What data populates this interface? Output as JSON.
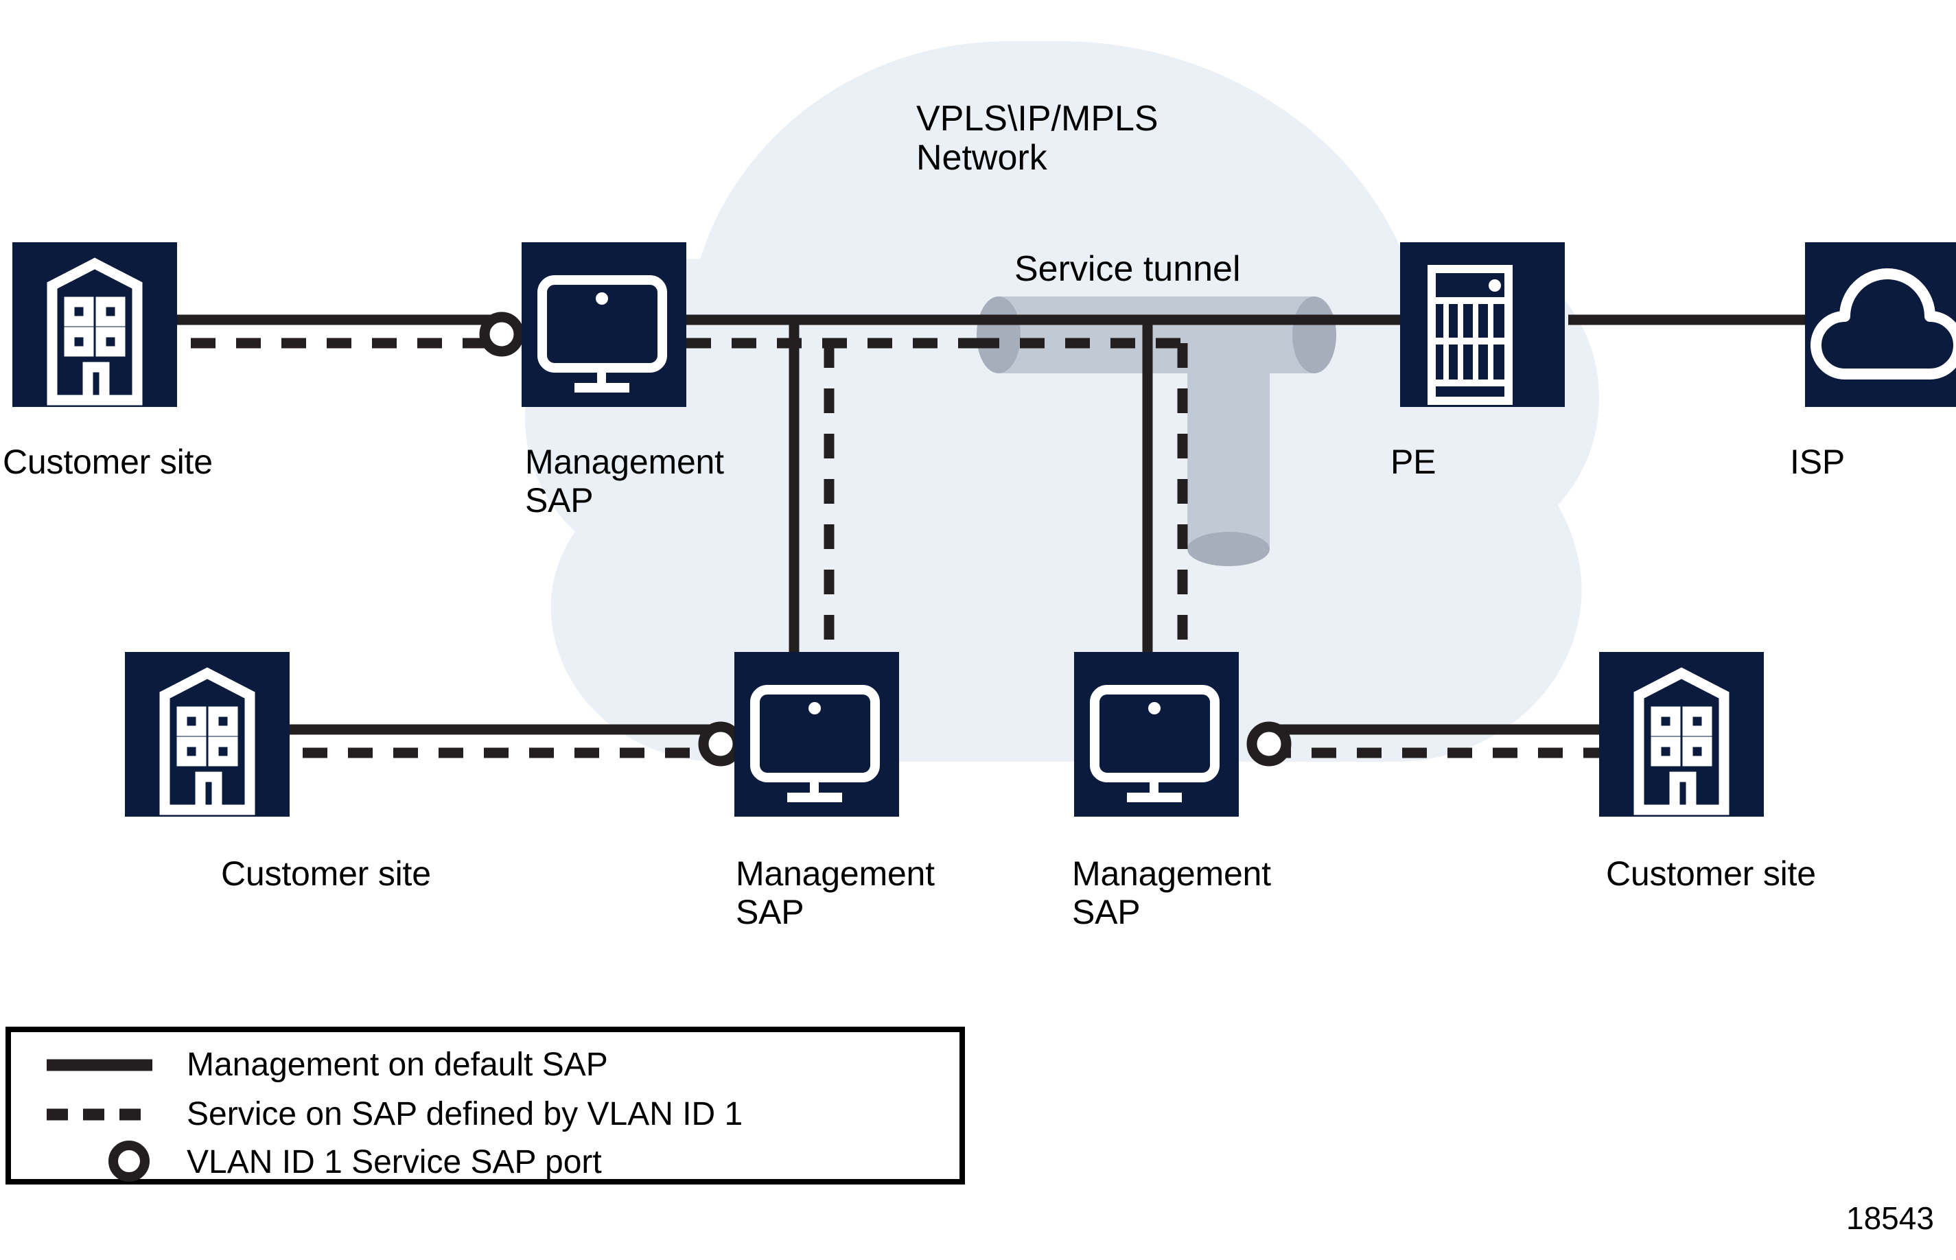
{
  "figure": {
    "number": "18543",
    "background_color": "#ffffff",
    "cloud_color": "#eaf0f5",
    "node_box_color": "#0a1b3d",
    "node_icon_color": "#ffffff",
    "line_color": "#231f20",
    "tunnel_body_color": "#c1c9d4",
    "tunnel_cap_color": "#a5aeba"
  },
  "cloud": {
    "title": "VPLS\\IP/MPLS\nNetwork"
  },
  "tunnel": {
    "label": "Service tunnel"
  },
  "nodes": [
    {
      "id": "customer-site-top-left",
      "label": "Customer site",
      "icon": "building-icon"
    },
    {
      "id": "management-sap-top-left",
      "label": "Management\nSAP",
      "icon": "monitor-icon"
    },
    {
      "id": "pe-router",
      "label": "PE",
      "icon": "router-rack-icon"
    },
    {
      "id": "isp-cloud",
      "label": "ISP",
      "icon": "cloud-icon"
    },
    {
      "id": "customer-site-bottom-left",
      "label": "Customer site",
      "icon": "building-icon"
    },
    {
      "id": "management-sap-bottom-left",
      "label": "Management\nSAP",
      "icon": "monitor-icon"
    },
    {
      "id": "management-sap-bottom-mid",
      "label": "Management\nSAP",
      "icon": "monitor-icon"
    },
    {
      "id": "customer-site-bottom-right",
      "label": "Customer site",
      "icon": "building-icon"
    }
  ],
  "legend": {
    "items": [
      {
        "symbol": "solid-line",
        "label": "Management on default SAP"
      },
      {
        "symbol": "dashed-line",
        "label": "Service on SAP defined by VLAN ID 1"
      },
      {
        "symbol": "circle-port",
        "label": "VLAN ID 1 Service SAP port"
      }
    ]
  }
}
